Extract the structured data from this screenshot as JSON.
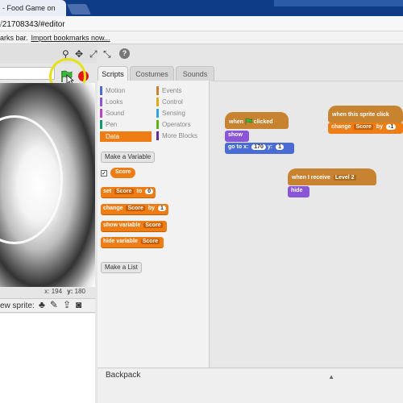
{
  "browser": {
    "tab_title": "- Food Game on",
    "url_grey": "/",
    "url_main": "21708343/#editor",
    "bookmarks_text": "arks bar.",
    "bookmarks_import": "Import bookmarks now..."
  },
  "stage": {
    "coord_x_label": "x:",
    "coord_x": "194",
    "coord_y_label": "y:",
    "coord_y": "180",
    "new_sprite_label": "ew sprite:"
  },
  "tabs": [
    "Scripts",
    "Costumes",
    "Sounds"
  ],
  "categories": {
    "motion": "Motion",
    "looks": "Looks",
    "sound": "Sound",
    "pen": "Pen",
    "data": "Data",
    "events": "Events",
    "control": "Control",
    "sensing": "Sensing",
    "operators": "Operators",
    "more_blocks": "More Blocks"
  },
  "category_colors": {
    "motion": "#4a6cd4",
    "looks": "#8a55d7",
    "sound": "#bb42c3",
    "pen": "#0e9a6c",
    "data": "#ee7d16",
    "events": "#c88330",
    "control": "#e1a91a",
    "sensing": "#2ca5e2",
    "operators": "#5cb712",
    "more_blocks": "#632d99"
  },
  "palette": {
    "make_variable": "Make a Variable",
    "variable_name": "Score",
    "set_block": {
      "prefix": "set",
      "var": "Score",
      "mid": "to",
      "value": "0"
    },
    "change_block": {
      "prefix": "change",
      "var": "Score",
      "mid": "by",
      "value": "1"
    },
    "show_block": {
      "prefix": "show variable",
      "var": "Score"
    },
    "hide_block": {
      "prefix": "hide variable",
      "var": "Score"
    },
    "make_list": "Make a List"
  },
  "scripts": {
    "s1_when": "when",
    "s1_clicked": "clicked",
    "s1_show": "show",
    "s1_goto": "go to x:",
    "s1_x": "170",
    "s1_y_label": "y:",
    "s1_y": "1",
    "s2_hat": "when this sprite click",
    "s2_change": "change",
    "s2_var": "Score",
    "s2_by": "by",
    "s2_value": "-1",
    "s3_hat": "when I receive",
    "s3_msg": "Level 2",
    "s3_hide": "hide"
  },
  "backpack": "Backpack"
}
